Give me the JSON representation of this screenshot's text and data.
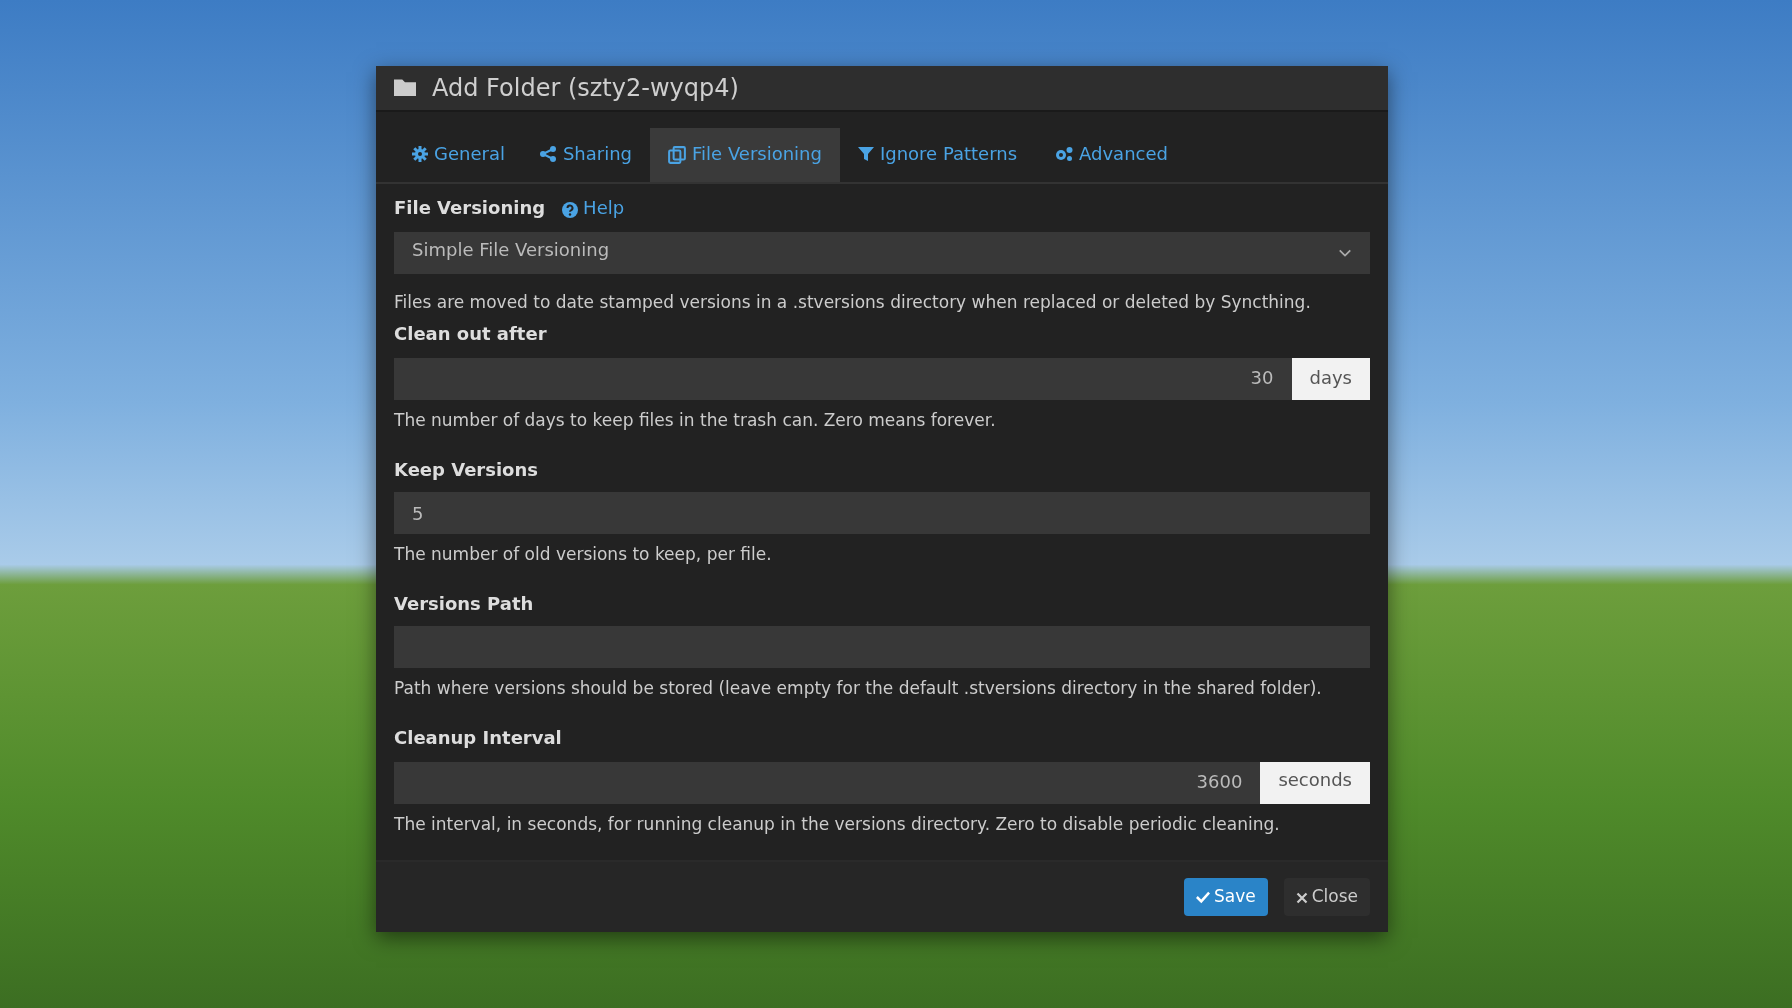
{
  "dialog": {
    "title": "Add Folder (szty2-wyqp4)"
  },
  "tabs": [
    {
      "label": "General",
      "selected": false
    },
    {
      "label": "Sharing",
      "selected": false
    },
    {
      "label": "File Versioning",
      "selected": true
    },
    {
      "label": "Ignore Patterns",
      "selected": false
    },
    {
      "label": "Advanced",
      "selected": false
    }
  ],
  "versioning": {
    "label": "File Versioning",
    "help_link": "Help",
    "value": "Simple File Versioning",
    "description": "Files are moved to date stamped versions in a .stversions directory when replaced or deleted by Syncthing."
  },
  "fields": [
    {
      "kind": "number",
      "label": "Clean out after",
      "value": "30",
      "unit": "days",
      "help": "The number of days to keep files in the trash can. Zero means forever."
    },
    {
      "kind": "text",
      "label": "Keep Versions",
      "value": "5",
      "help": "The number of old versions to keep, per file."
    },
    {
      "kind": "text",
      "label": "Versions Path",
      "help": "Path where versions should be stored (leave empty for the default .stversions directory in the shared folder)."
    },
    {
      "kind": "number",
      "label": "Cleanup Interval",
      "value": "3600",
      "unit": "seconds",
      "help": "The interval, in seconds, for running cleanup in the versions directory. Zero to disable periodic cleaning."
    }
  ],
  "buttons": [
    {
      "kind": "primary",
      "label": "Save"
    },
    {
      "kind": "secondary",
      "label": "Close"
    }
  ]
}
